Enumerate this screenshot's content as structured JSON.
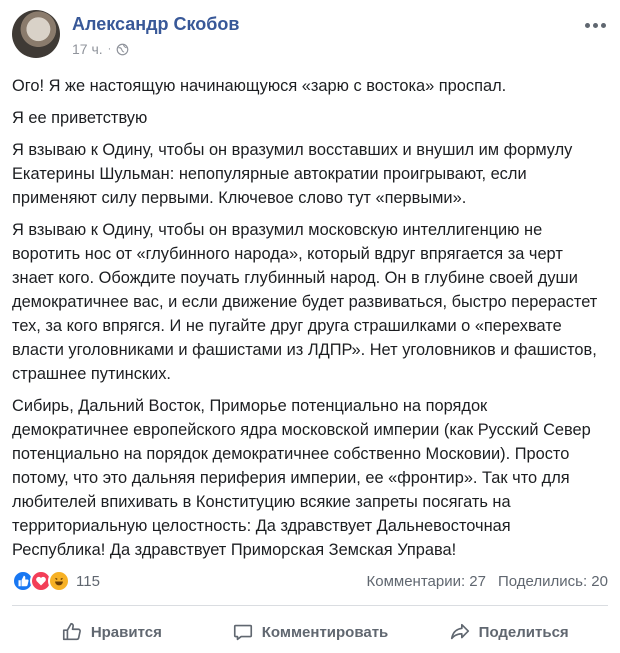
{
  "post": {
    "author": "Александр Скобов",
    "time": "17 ч.",
    "separator": "·",
    "paragraphs": [
      "Ого! Я же настоящую начинающуюся «зарю с востока» проспал.",
      "Я ее приветствую",
      "Я взываю к Одину, чтобы он вразумил восставших и внушил им формулу Екатерины Шульман: непопулярные автократии проигрывают, если применяют силу первыми. Ключевое слово тут «первыми».",
      "Я взываю к Одину, чтобы он вразумил московскую интеллигенцию не воротить нос от «глубинного народа», который вдруг впрягается за черт знает кого. Обождите поучать глубинный народ. Он в глубине своей души демократичнее вас, и если движение будет развиваться, быстро перерастет тех, за кого впрягся. И не пугайте друг друга страшилками о «перехвате власти уголовниками и фашистами из ЛДПР». Нет уголовников и фашистов, страшнее путинских.",
      "Сибирь, Дальний Восток, Приморье потенциально на порядок демократичнее европейского ядра московской империи (как Русский Север потенциально на порядок демократичнее собственно Московии). Просто потому, что это дальняя периферия империи, ее «фронтир». Так что для любителей впихивать в Конституцию всякие запреты посягать на территориальную целостность: Да здравствует Дальневосточная Республика! Да здравствует Приморская Земская Управа!"
    ]
  },
  "stats": {
    "reaction_count": "115",
    "comments": "Комментарии: 27",
    "shares": "Поделились: 20"
  },
  "actions": {
    "like": "Нравится",
    "comment": "Комментировать",
    "share": "Поделиться"
  },
  "colors": {
    "author": "#385898",
    "muted": "#90949c",
    "action": "#606770",
    "like": "#1877f2",
    "love": "#f33e58",
    "haha": "#f7b125"
  },
  "icons": [
    "more-options-icon",
    "globe-icon",
    "like-reaction-icon",
    "love-reaction-icon",
    "haha-reaction-icon",
    "thumbs-up-icon",
    "comment-icon",
    "share-icon"
  ]
}
